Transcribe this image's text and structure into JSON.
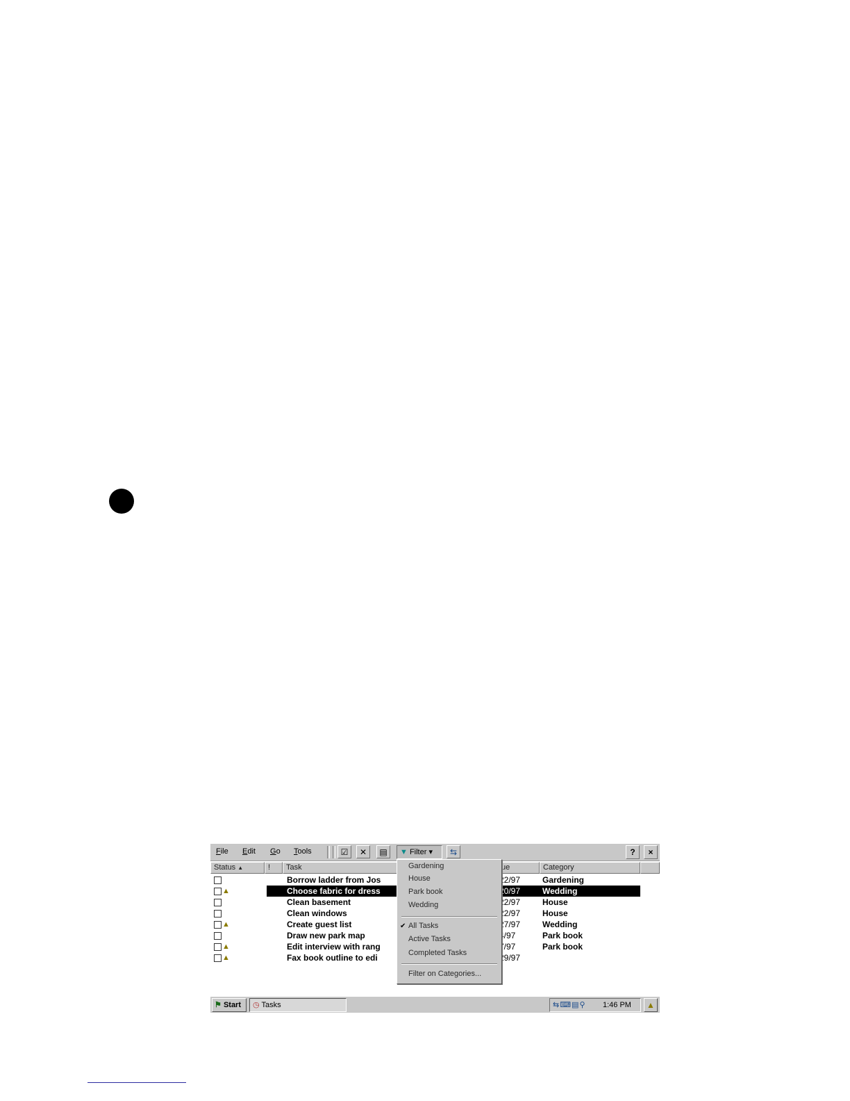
{
  "menubar": {
    "items": [
      "File",
      "Edit",
      "Go",
      "Tools"
    ],
    "filter_label": "Filter"
  },
  "columns": {
    "status": "Status",
    "priority": "!",
    "task": "Task",
    "due": "ue",
    "category": "Category"
  },
  "rows": [
    {
      "task": "Borrow ladder from Jos",
      "due": "22/97",
      "category": "Gardening",
      "priority": false,
      "selected": false
    },
    {
      "task": "Choose fabric for dress",
      "due": "20/97",
      "category": "Wedding",
      "priority": true,
      "selected": true
    },
    {
      "task": "Clean basement",
      "due": "22/97",
      "category": "House",
      "priority": false,
      "selected": false
    },
    {
      "task": "Clean windows",
      "due": "22/97",
      "category": "House",
      "priority": false,
      "selected": false
    },
    {
      "task": "Create guest list",
      "due": "27/97",
      "category": "Wedding",
      "priority": true,
      "selected": false
    },
    {
      "task": "Draw new park map",
      "due": "4/97",
      "category": "Park book",
      "priority": false,
      "selected": false
    },
    {
      "task": "Edit interview with rang",
      "due": "7/97",
      "category": "Park book",
      "priority": true,
      "selected": false
    },
    {
      "task": "Fax book outline to edi",
      "due": "29/97",
      "category": "",
      "priority": true,
      "selected": false
    }
  ],
  "filter_menu": {
    "categories": [
      "Gardening",
      "House",
      "Park book",
      "Wedding"
    ],
    "views": [
      "All Tasks",
      "Active Tasks",
      "Completed Tasks"
    ],
    "checked_view": "All Tasks",
    "more": "Filter on Categories..."
  },
  "taskbar": {
    "start_label": "Start",
    "task_label": "Tasks",
    "time": "1:46 PM"
  }
}
